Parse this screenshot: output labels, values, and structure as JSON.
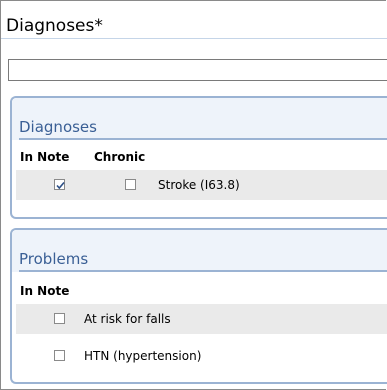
{
  "title": "Diagnoses*",
  "search": {
    "value": "",
    "placeholder": ""
  },
  "diagnoses_panel": {
    "header": "Diagnoses",
    "columns": {
      "in_note": "In Note",
      "chronic": "Chronic"
    },
    "rows": [
      {
        "label": "Stroke (I63.8)",
        "in_note": true,
        "chronic": false
      }
    ]
  },
  "problems_panel": {
    "header": "Problems",
    "columns": {
      "in_note": "In Note"
    },
    "rows": [
      {
        "label": "At risk for falls",
        "in_note": false
      },
      {
        "label": "HTN (hypertension)",
        "in_note": false
      }
    ]
  },
  "colors": {
    "panel_border": "#9bb3d3",
    "panel_header_text": "#3a5f95",
    "panel_header_bg": "#eef3fa",
    "row_shade": "#eaeaea",
    "checkmark": "#2c4f86"
  }
}
